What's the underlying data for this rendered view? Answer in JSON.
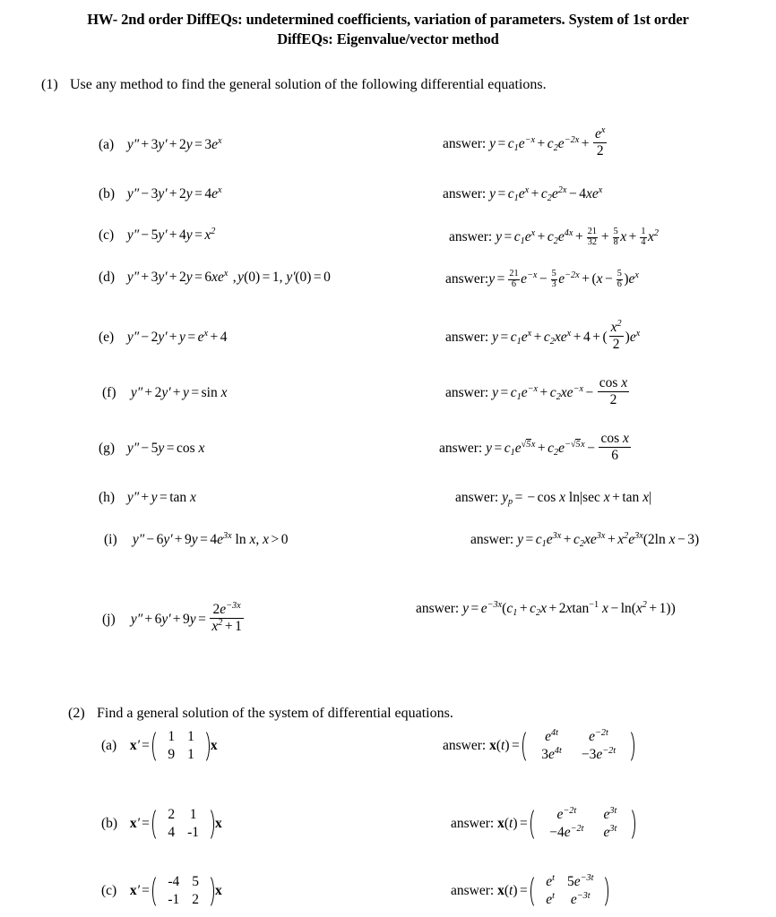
{
  "document": {
    "title_line1": "HW- 2nd order DiffEQs: undetermined coefficients, variation of parameters. System of 1st order",
    "title_line2": "DiffEQs: Eigenvalue/vector method"
  },
  "problem1": {
    "number": "(1)",
    "prompt": "Use any method to find the general solution of the following differential equations.",
    "answer_label": "answer:",
    "items": [
      {
        "label": "(a)",
        "equation_text": "y'' + 3y' + 2y = 3e^x",
        "answer_text": "y = c_1 e^{-x} + c_2 e^{-2x} + e^x/2"
      },
      {
        "label": "(b)",
        "equation_text": "y'' - 3y' + 2y = 4e^x",
        "answer_text": "y = c_1 e^x + c_2 e^{2x} - 4xe^x"
      },
      {
        "label": "(c)",
        "equation_text": "y'' - 5y' + 4y = x^2",
        "answer_text": "y = c_1 e^x + c_2 e^{4x} + 21/32 + (5/8)x + (1/4)x^2"
      },
      {
        "label": "(d)",
        "equation_text": "y'' + 3y' + 2y = 6xe^x , y(0) = 1, y'(0) = 0",
        "answer_text": "y = (21/6)e^{-x} - (5/3)e^{-2x} + (x - 5/6)e^x"
      },
      {
        "label": "(e)",
        "equation_text": "y'' - 2y' + y = e^x + 4",
        "answer_text": "y = c_1 e^x + c_2 xe^x + 4 + (x^2/2)e^x"
      },
      {
        "label": "(f)",
        "equation_text": "y'' + 2y' + y = sin x",
        "answer_text": "y = c_1 e^{-x} + c_2 xe^{-x} - cos x/2"
      },
      {
        "label": "(g)",
        "equation_text": "y'' - 5y = cos x",
        "answer_text": "y = c_1 e^{sqrt5 x} + c_2 e^{-sqrt5 x} - cos x/6"
      },
      {
        "label": "(h)",
        "equation_text": "y'' + y = tan x",
        "answer_text": "y_p = - cos x ln|sec x + tan x|"
      },
      {
        "label": "(i)",
        "equation_text": "y'' - 6y' + 9y = 4e^{3x} ln x, x > 0",
        "answer_text": "y = c_1 e^{3x} + c_2 xe^{3x} + x^2 e^{3x}(2 ln x - 3)"
      },
      {
        "label": "(j)",
        "equation_text": "y'' + 6y' + 9y = 2e^{-3x}/(x^2 + 1)",
        "answer_text": "y = e^{-3x}(c_1 + c_2 x + 2x tan^{-1} x - ln(x^2 + 1))"
      }
    ]
  },
  "problem2": {
    "number": "(2)",
    "prompt": "Find a general solution of the system of differential equations.",
    "answer_label": "answer:",
    "items": [
      {
        "label": "(a)",
        "matrix": [
          [
            "1",
            "1"
          ],
          [
            "9",
            "1"
          ]
        ],
        "answer_matrix": [
          [
            "e^{4t}",
            "e^{-2t}"
          ],
          [
            "3e^{4t}",
            "-3e^{-2t}"
          ]
        ]
      },
      {
        "label": "(b)",
        "matrix": [
          [
            "2",
            "1"
          ],
          [
            "4",
            "-1"
          ]
        ],
        "answer_matrix": [
          [
            "e^{-2t}",
            "e^{3t}"
          ],
          [
            "-4e^{-2t}",
            "e^{3t}"
          ]
        ]
      },
      {
        "label": "(c)",
        "matrix": [
          [
            "-4",
            "5"
          ],
          [
            "-1",
            "2"
          ]
        ],
        "answer_matrix": [
          [
            "e^{t}",
            "5e^{-3t}"
          ],
          [
            "e^{t}",
            "e^{-3t}"
          ]
        ]
      }
    ]
  }
}
